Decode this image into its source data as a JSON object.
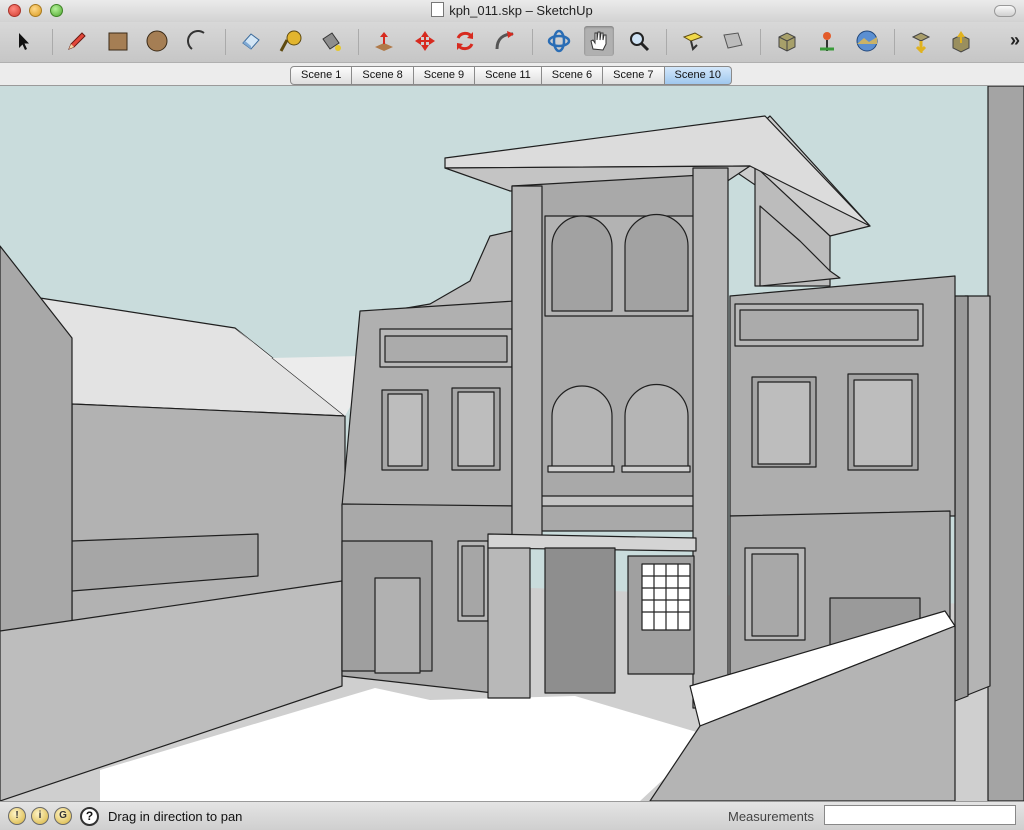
{
  "window": {
    "title": "kph_011.skp – SketchUp"
  },
  "toolbar": {
    "tools": [
      {
        "name": "select-tool"
      },
      {
        "name": "line-tool"
      },
      {
        "name": "rectangle-tool"
      },
      {
        "name": "circle-tool"
      },
      {
        "name": "arc-tool"
      },
      {
        "name": "eraser-tool"
      },
      {
        "name": "tape-measure-tool"
      },
      {
        "name": "paint-bucket-tool"
      },
      {
        "name": "push-pull-tool"
      },
      {
        "name": "move-tool"
      },
      {
        "name": "rotate-tool"
      },
      {
        "name": "follow-me-tool"
      },
      {
        "name": "orbit-tool"
      },
      {
        "name": "pan-tool",
        "active": true
      },
      {
        "name": "zoom-tool"
      },
      {
        "name": "zoom-extents-tool"
      },
      {
        "name": "previous-view-tool"
      },
      {
        "name": "get-models-tool"
      },
      {
        "name": "add-location-tool"
      },
      {
        "name": "toggle-terrain-tool"
      },
      {
        "name": "share-model-tool"
      },
      {
        "name": "components-tool"
      }
    ],
    "more": "»"
  },
  "scenes": {
    "tabs": [
      "Scene 1",
      "Scene 8",
      "Scene 9",
      "Scene 11",
      "Scene 6",
      "Scene 7",
      "Scene 10"
    ],
    "selected": "Scene 10"
  },
  "status": {
    "icons": [
      "geo-location-icon",
      "credits-icon",
      "google-icon"
    ],
    "help": "?",
    "message": "Drag in direction to pan",
    "measurements_label": "Measurements",
    "measurements_value": ""
  },
  "colors": {
    "sky": "#c9dcdc",
    "facade": "#a9a9a9",
    "roof": "#e6e6e6",
    "ground": "#ffffff",
    "selected_scene": "#a8cdf0"
  }
}
